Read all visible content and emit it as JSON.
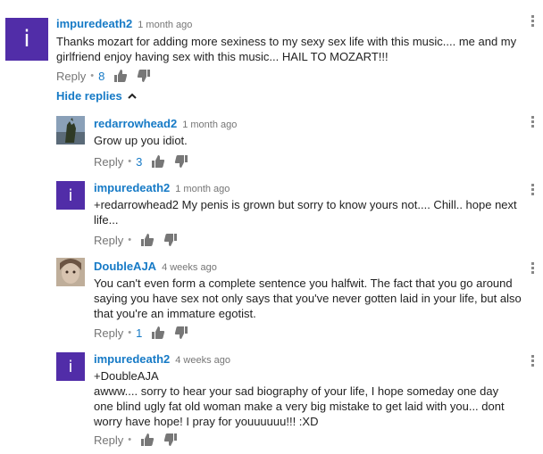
{
  "comments": [
    {
      "author": "impuredeath2",
      "time": "1 month ago",
      "text": "Thanks mozart for adding more sexiness to my sexy sex life with this music.... me and my girlfriend enjoy having sex with this music... HAIL TO MOZART!!!",
      "avatar_letter": "i",
      "avatar_color": "#512da8",
      "reply_label": "Reply",
      "likes": "8"
    }
  ],
  "hide_replies_label": "Hide replies",
  "replies": [
    {
      "author": "redarrowhead2",
      "time": "1 month ago",
      "text": "Grow up you idiot.",
      "avatar_kind": "photo",
      "reply_label": "Reply",
      "likes": "3"
    },
    {
      "author": "impuredeath2",
      "time": "1 month ago",
      "text": "+redarrowhead2 My penis is grown but sorry to know yours not.... Chill.. hope next life...",
      "avatar_letter": "i",
      "avatar_color": "#512da8",
      "reply_label": "Reply",
      "likes": ""
    },
    {
      "author": "DoubleAJA",
      "time": "4 weeks ago",
      "text": "You can't even form a complete sentence you halfwit.  The fact that you go around saying you have sex not only says that you've never gotten laid in your life, but also that you're an immature egotist.",
      "avatar_kind": "photo",
      "reply_label": "Reply",
      "likes": "1"
    },
    {
      "author": "impuredeath2",
      "time": "4 weeks ago",
      "text_line1": "+DoubleAJA",
      "text_line2": "awww.... sorry to hear your sad biography of your life, I hope someday one day one blind ugly fat old woman make a very big mistake to get laid with you... dont worry have hope! I pray for youuuuuu!!! :XD",
      "avatar_letter": "i",
      "avatar_color": "#512da8",
      "reply_label": "Reply",
      "likes": ""
    }
  ]
}
